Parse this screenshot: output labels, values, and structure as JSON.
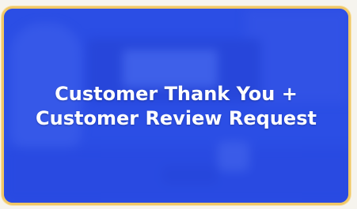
{
  "card": {
    "title": "Customer Thank You + Customer Review Request",
    "border_color": "#f0c766",
    "background_color": "#3152e4"
  }
}
